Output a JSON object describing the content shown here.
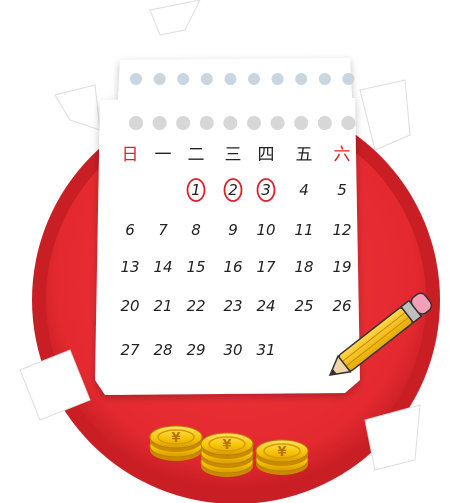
{
  "calendar": {
    "weekdays": [
      "日",
      "一",
      "二",
      "三",
      "四",
      "五",
      "六"
    ],
    "weekday_colors": [
      "#e02020",
      "#222222",
      "#222222",
      "#222222",
      "#222222",
      "#222222",
      "#e02020"
    ],
    "rows": [
      [
        "",
        "",
        "1",
        "2",
        "3",
        "4",
        "5"
      ],
      [
        "6",
        "7",
        "8",
        "9",
        "10",
        "11",
        "12"
      ],
      [
        "13",
        "14",
        "15",
        "16",
        "17",
        "18",
        "19"
      ],
      [
        "20",
        "21",
        "22",
        "23",
        "24",
        "25",
        "26"
      ],
      [
        "27",
        "28",
        "29",
        "30",
        "31",
        "",
        ""
      ]
    ],
    "circled_days": [
      "1",
      "2",
      "3"
    ],
    "circle_color": "#e0202a"
  },
  "icons": {
    "pencil": "pencil-icon",
    "coins": "yuan-coin-icon",
    "coin_symbol": "¥"
  },
  "colors": {
    "badge_red": "#e8282e",
    "badge_dark_red": "#c81e24",
    "paper": "#ffffff",
    "coin_gold": "#f5c200"
  }
}
